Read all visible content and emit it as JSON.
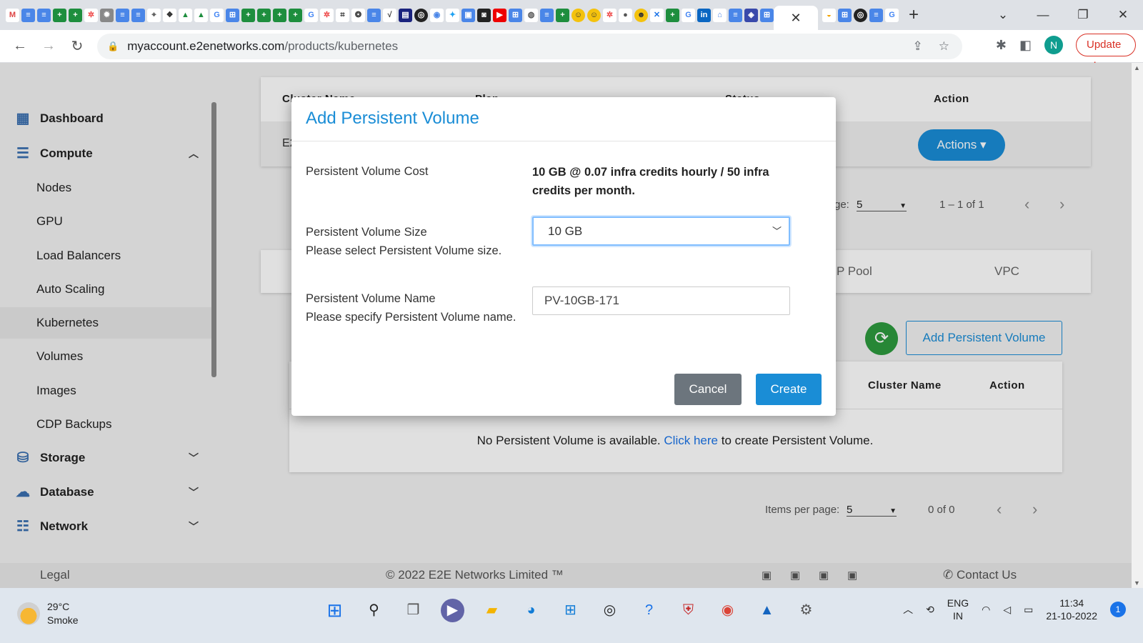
{
  "browser": {
    "url_domain": "myaccount.e2enetworks.com",
    "url_path": "/products/kubernetes",
    "update_label": "Update",
    "avatar_letter": "N",
    "close_tab": "✕",
    "new_tab": "+"
  },
  "sidebar": {
    "dashboard": "Dashboard",
    "compute": "Compute",
    "compute_items": [
      "Nodes",
      "GPU",
      "Load Balancers",
      "Auto Scaling",
      "Kubernetes",
      "Volumes",
      "Images",
      "CDP Backups"
    ],
    "active_item": "Kubernetes",
    "storage": "Storage",
    "database": "Database",
    "network": "Network"
  },
  "cluster_table": {
    "headers": [
      "Cluster Name",
      "Plan",
      "Status",
      "Action"
    ],
    "row_first_cell": "E2",
    "actions_label": "Actions ▾",
    "items_per_page_label": "ge:",
    "items_per_page": "5",
    "range": "1 – 1 of 1"
  },
  "tabs": {
    "ip_pool": "P Pool",
    "vpc": "VPC"
  },
  "pv_table": {
    "add_button": "Add Persistent Volume",
    "headers": [
      "Cluster Name",
      "Action"
    ],
    "empty_prefix": "No Persistent Volume is available.",
    "empty_link": "Click here",
    "empty_suffix": "to create Persistent Volume.",
    "items_per_page_label": "Items per page:",
    "items_per_page": "5",
    "range": "0 of 0"
  },
  "footer": {
    "legal": "Legal",
    "copyright": "© 2022 E2E Networks Limited ™",
    "contact": "Contact Us"
  },
  "modal": {
    "title": "Add Persistent Volume",
    "cost_label": "Persistent Volume Cost",
    "cost_value": "10 GB @ 0.07 infra credits hourly / 50 infra credits per month.",
    "size_label": "Persistent Volume Size",
    "size_help": "Please select Persistent Volume size.",
    "size_value": "10 GB",
    "name_label": "Persistent Volume Name",
    "name_help": "Please specify Persistent Volume name.",
    "name_value": "PV-10GB-171",
    "cancel_label": "Cancel",
    "create_label": "Create"
  },
  "taskbar": {
    "temp": "29°C",
    "weather": "Smoke",
    "lang_top": "ENG",
    "lang_bottom": "IN",
    "time": "11:34",
    "date": "21-10-2022",
    "notifications": "1"
  },
  "colors": {
    "accent": "#1a8dd6",
    "cancel": "#6c757d",
    "refresh": "#2d9a3e"
  }
}
